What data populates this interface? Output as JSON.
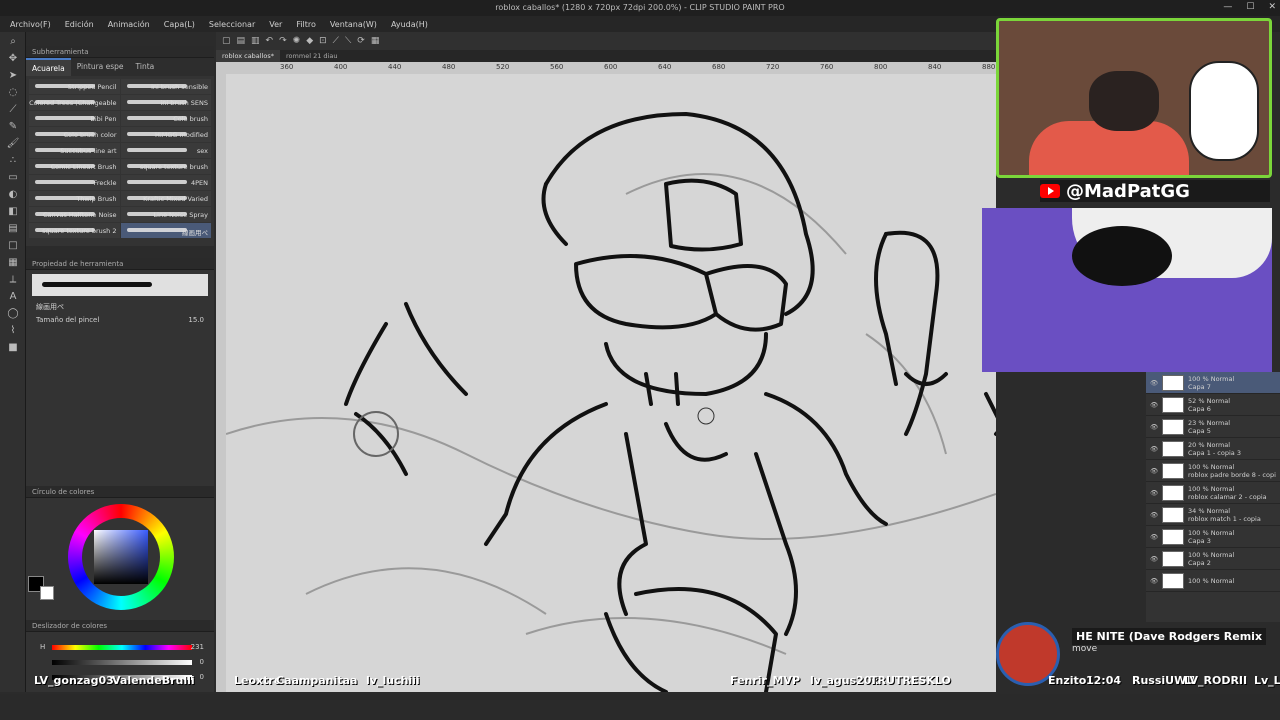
{
  "window": {
    "title": "roblox caballos* (1280 x 720px 72dpi 200.0%) - CLIP STUDIO PAINT PRO"
  },
  "menu": [
    "Archivo(F)",
    "Edición",
    "Animación",
    "Capa(L)",
    "Seleccionar",
    "Ver",
    "Filtro",
    "Ventana(W)",
    "Ayuda(H)"
  ],
  "subtool": {
    "panel_title": "Subherramienta",
    "tabs": [
      "Acuarela",
      "Pintura espe",
      "Tinta"
    ],
    "brushes": [
      {
        "label": "Stripped Pencil"
      },
      {
        "label": "ini brush sensible"
      },
      {
        "label": "Colored Trees (Changeable"
      },
      {
        "label": "ini brush SENS"
      },
      {
        "label": "Bibi Pen"
      },
      {
        "label": "Colo brush"
      },
      {
        "label": "Colo brush color"
      },
      {
        "label": "HIMGG modified"
      },
      {
        "label": "Succubus line art"
      },
      {
        "label": "sex"
      },
      {
        "label": "Comic Lineart Brush"
      },
      {
        "label": "square texture brush"
      },
      {
        "label": "Freckle"
      },
      {
        "label": "4PEN"
      },
      {
        "label": "Thwip Brush"
      },
      {
        "label": "Kraftic Mixed Varied"
      },
      {
        "label": "Canvas Halftone Noise"
      },
      {
        "label": "Line Noise Spray"
      },
      {
        "label": "square texture brush 2"
      },
      {
        "label": "線画用ペ"
      }
    ]
  },
  "tool_property": {
    "panel_title": "Propiedad de herramienta",
    "brush_name": "線画用ペ",
    "size_label": "Tamaño del pincel",
    "size_value": "15.0"
  },
  "color_wheel": {
    "panel_title": "Círculo de colores",
    "main_color": "#000000",
    "sub_color": "#ffffff"
  },
  "color_sliders": {
    "panel_title": "Deslizador de colores",
    "h_label": "H",
    "h_value": "231",
    "s_value": "0",
    "v_value": "0"
  },
  "doc_tabs": [
    "roblox caballos*",
    "rommel 21 diau"
  ],
  "ruler_ticks": [
    "360",
    "400",
    "440",
    "480",
    "520",
    "560",
    "600",
    "640",
    "680",
    "720",
    "760",
    "800",
    "840",
    "880"
  ],
  "stream": {
    "handle": "@MadPatGG",
    "song": "HE NITE (Dave Rodgers Remix",
    "artist": "move",
    "time": "12:04"
  },
  "layers": [
    {
      "opacity": "100 % Normal",
      "name": "Capa 7",
      "selected": true
    },
    {
      "opacity": "52 % Normal",
      "name": "Capa 6"
    },
    {
      "opacity": "23 % Normal",
      "name": "Capa 5"
    },
    {
      "opacity": "20 % Normal",
      "name": "Capa 1 - copia 3"
    },
    {
      "opacity": "100 % Normal",
      "name": "roblox padre borde 8 - copi"
    },
    {
      "opacity": "100 % Normal",
      "name": "roblox calamar 2 - copia"
    },
    {
      "opacity": "34 % Normal",
      "name": "roblox match 1 - copia"
    },
    {
      "opacity": "100 % Normal",
      "name": "Capa 3"
    },
    {
      "opacity": "100 % Normal",
      "name": "Capa 2"
    },
    {
      "opacity": "100 % Normal",
      "name": ""
    }
  ],
  "chat_names": [
    "LV_gonzag03",
    "ValendeBrulli",
    "Leoxtre",
    "Caampanitaa",
    "lv_luchiii",
    "Fenrir_MVP",
    "lv_agus20x",
    "TRUTRESKLO",
    "Enzito1",
    "RussiUWU",
    "LV_RODRII",
    "Lv_La"
  ]
}
